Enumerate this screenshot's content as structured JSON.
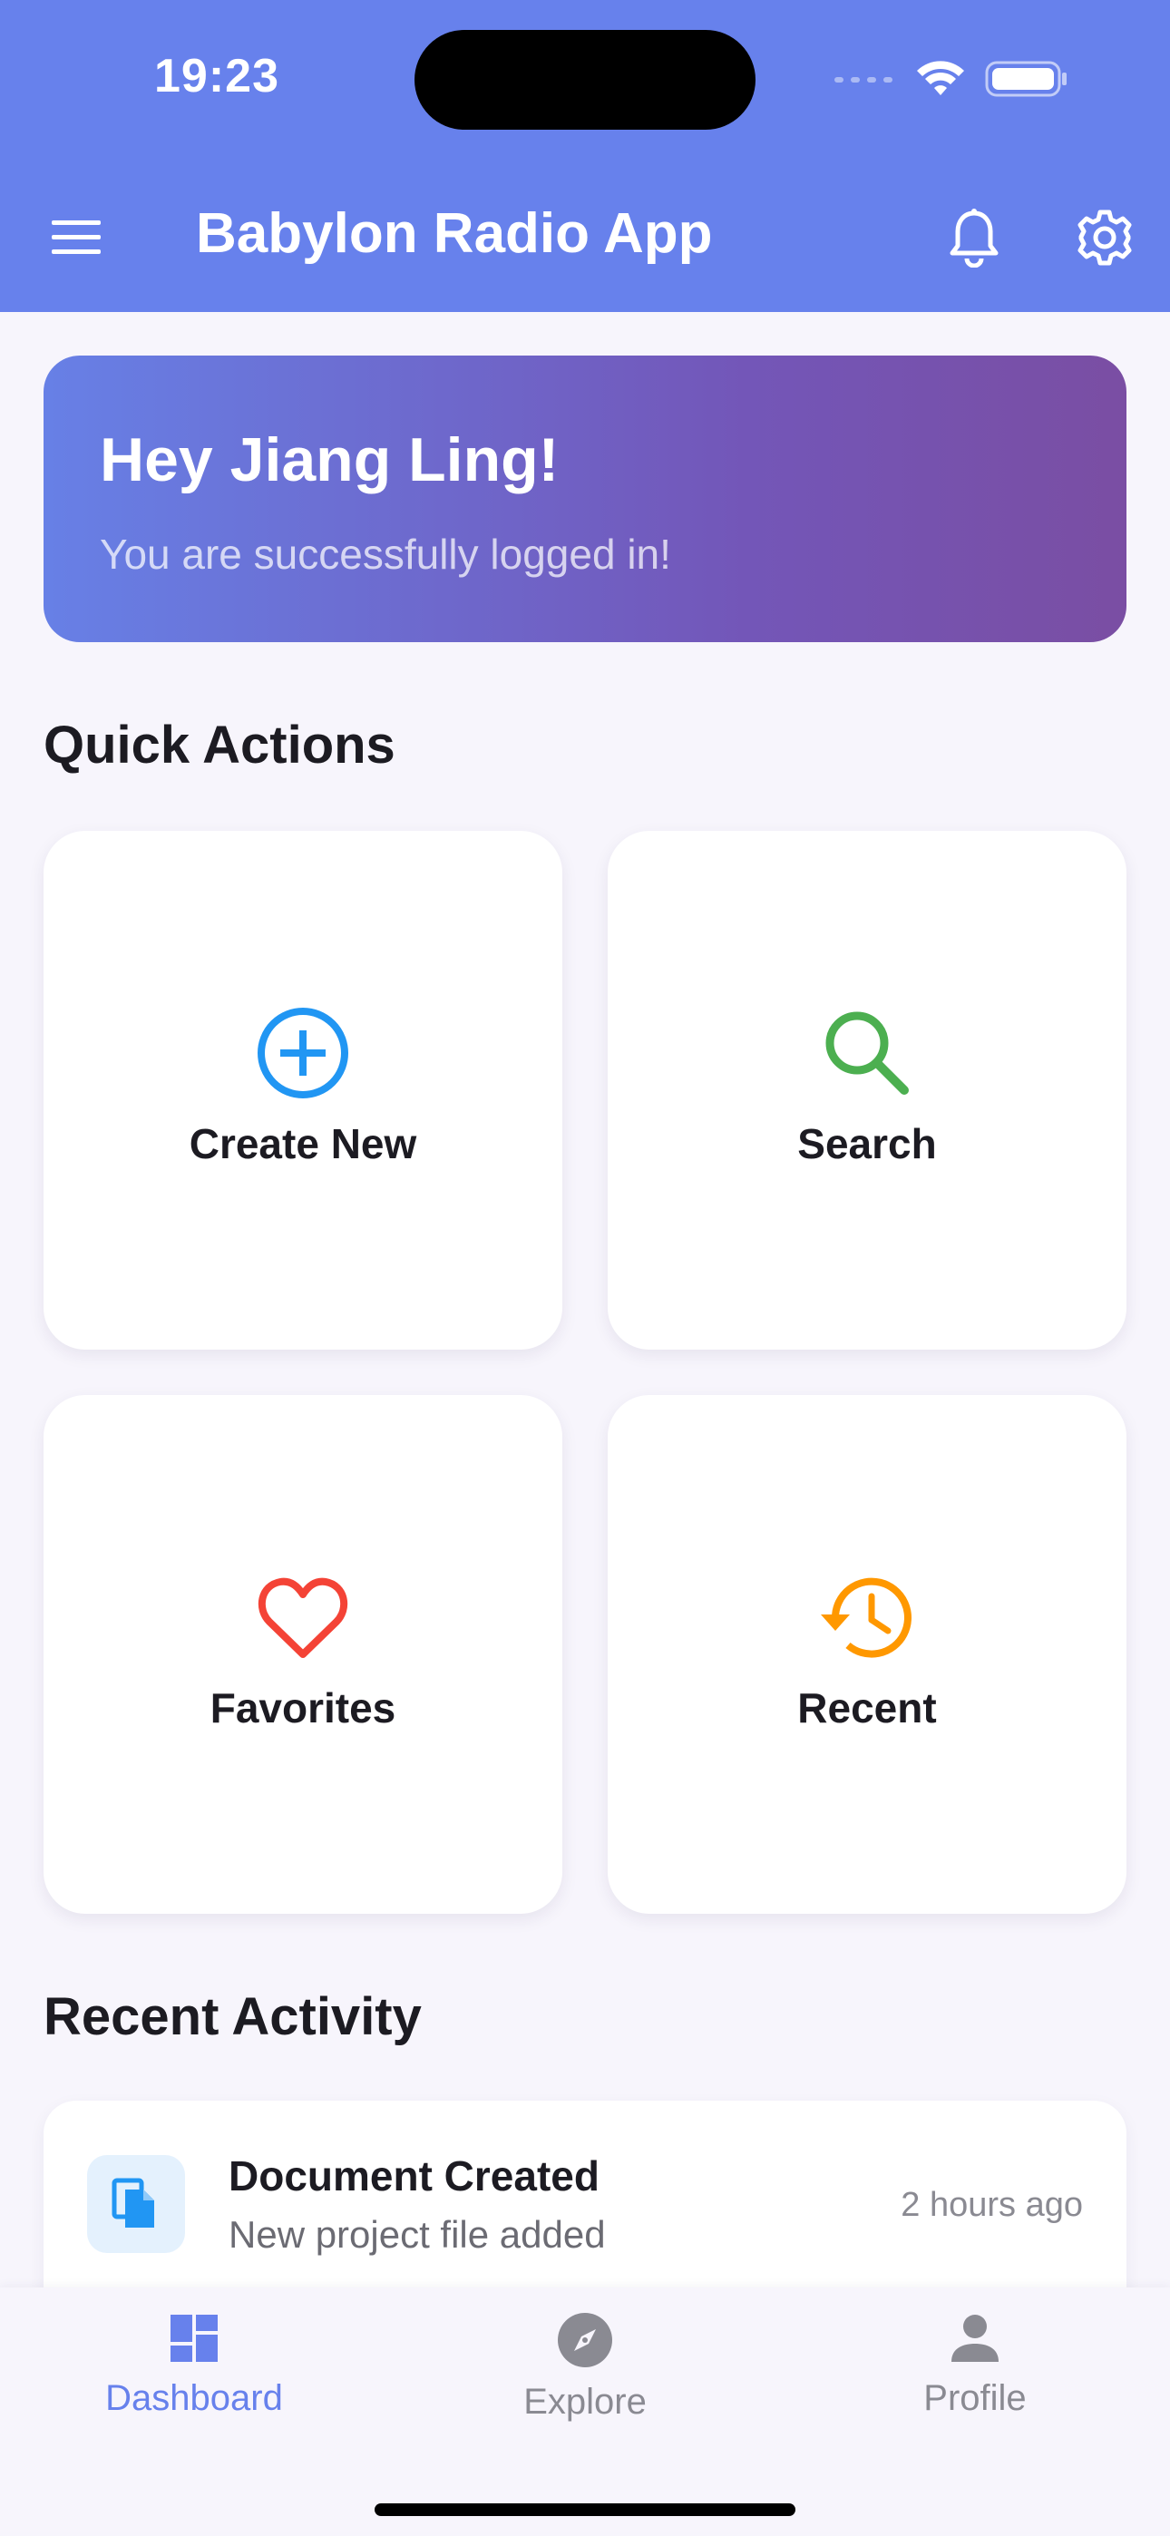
{
  "status_bar": {
    "time": "19:23"
  },
  "app_bar": {
    "title": "Babylon Radio App"
  },
  "welcome": {
    "title": "Hey Jiang Ling!",
    "subtitle": "You are successfully logged in!"
  },
  "quick_actions": {
    "title": "Quick Actions",
    "items": [
      {
        "label": "Create New",
        "icon": "add-circle-icon",
        "color": "#2196f3"
      },
      {
        "label": "Search",
        "icon": "search-icon",
        "color": "#4caf50"
      },
      {
        "label": "Favorites",
        "icon": "heart-icon",
        "color": "#f44336"
      },
      {
        "label": "Recent",
        "icon": "history-icon",
        "color": "#ff9800"
      }
    ]
  },
  "recent_activity": {
    "title": "Recent Activity",
    "items": [
      {
        "title": "Document Created",
        "subtitle": "New project file added",
        "time": "2 hours ago",
        "icon": "file-copy-icon",
        "color": "#2196f3"
      }
    ]
  },
  "bottom_nav": {
    "items": [
      {
        "label": "Dashboard",
        "icon": "dashboard-icon",
        "active": true
      },
      {
        "label": "Explore",
        "icon": "explore-icon",
        "active": false
      },
      {
        "label": "Profile",
        "icon": "person-icon",
        "active": false
      }
    ]
  },
  "colors": {
    "primary": "#6781ec",
    "gradient_end": "#7a4ea3",
    "background": "#f7f5fc",
    "text": "#1c1b22"
  }
}
